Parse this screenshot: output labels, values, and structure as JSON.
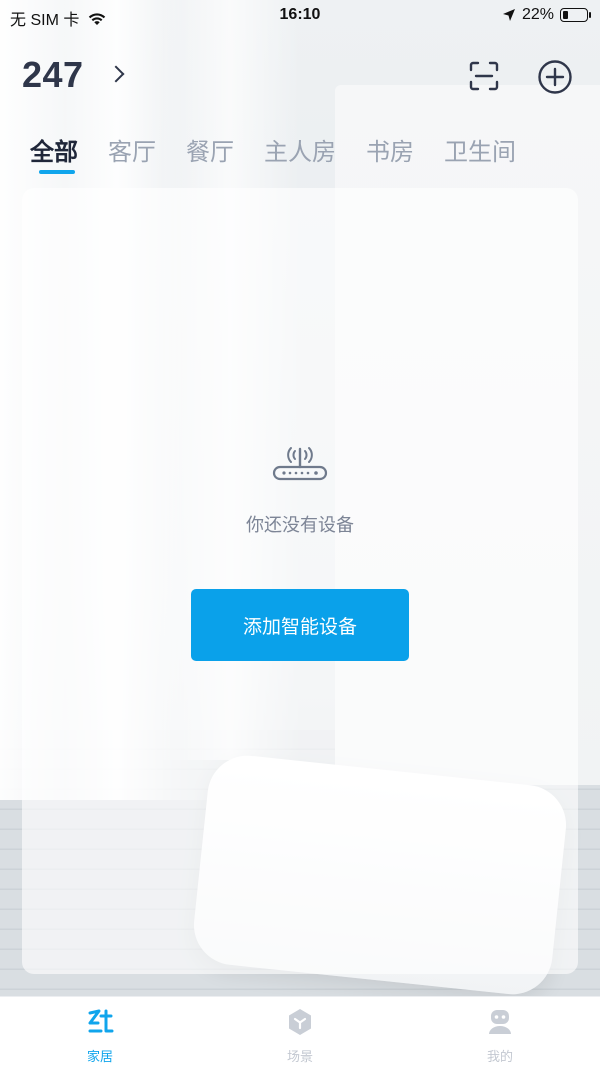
{
  "status_bar": {
    "carrier": "无 SIM 卡",
    "time": "16:10",
    "battery_percent": "22%"
  },
  "header": {
    "home_name": "247",
    "scan_icon": "scan-icon",
    "add_icon": "plus-circle-icon"
  },
  "tabs": [
    {
      "label": "全部",
      "active": true
    },
    {
      "label": "客厅",
      "active": false
    },
    {
      "label": "餐厅",
      "active": false
    },
    {
      "label": "主人房",
      "active": false
    },
    {
      "label": "书房",
      "active": false
    },
    {
      "label": "卫生间",
      "active": false
    }
  ],
  "empty_state": {
    "icon": "router-icon",
    "message": "你还没有设备",
    "button_label": "添加智能设备"
  },
  "tab_bar": [
    {
      "label": "家居",
      "icon": "home-icon",
      "active": true
    },
    {
      "label": "场景",
      "icon": "scene-icon",
      "active": false
    },
    {
      "label": "我的",
      "icon": "profile-icon",
      "active": false
    }
  ],
  "colors": {
    "accent": "#10a5ec",
    "button": "#0aa1ea",
    "text_primary": "#20273a",
    "text_inactive": "#9aa3b2"
  }
}
